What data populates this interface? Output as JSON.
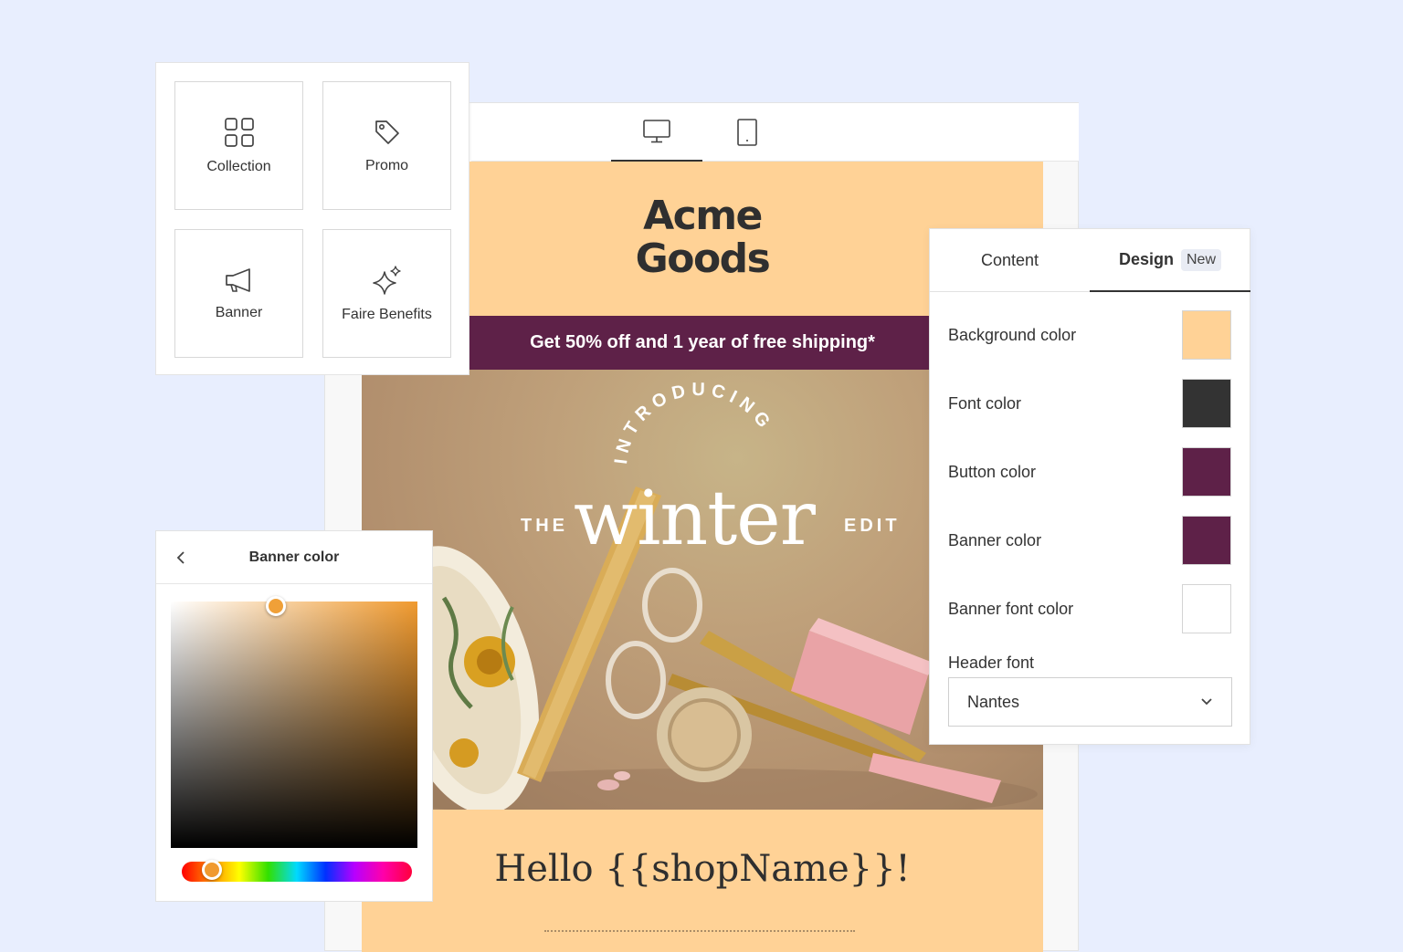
{
  "palette": {
    "items": [
      {
        "label": "Collection",
        "icon": "grid-icon"
      },
      {
        "label": "Promo",
        "icon": "tag-icon"
      },
      {
        "label": "Banner",
        "icon": "megaphone-icon"
      },
      {
        "label": "Faire Benefits",
        "icon": "sparkle-icon"
      }
    ]
  },
  "preview": {
    "devices": [
      {
        "label": "desktop",
        "icon": "desktop-icon",
        "active": true
      },
      {
        "label": "tablet",
        "icon": "tablet-icon",
        "active": false
      }
    ]
  },
  "email": {
    "logo_line1": "Acme",
    "logo_line2": "Goods",
    "banner_text": "Get 50% off and 1 year of free shipping*",
    "hero_introducing": "INTRODUCING",
    "hero_the": "THE",
    "hero_winter": "winter",
    "hero_edit": "EDIT",
    "greeting": "Hello {{shopName}}!"
  },
  "picker": {
    "title": "Banner color",
    "hue_color": "#f09a2f"
  },
  "design_panel": {
    "tabs": [
      {
        "label": "Content",
        "active": false
      },
      {
        "label": "Design",
        "active": true,
        "badge": "New"
      }
    ],
    "settings": [
      {
        "label": "Background color",
        "color": "#ffd296"
      },
      {
        "label": "Font color",
        "color": "#333333"
      },
      {
        "label": "Button color",
        "color": "#5e2148"
      },
      {
        "label": "Banner color",
        "color": "#5e2148"
      },
      {
        "label": "Banner font color",
        "color": "#ffffff"
      }
    ],
    "header_font_label": "Header font",
    "header_font_value": "Nantes"
  },
  "colors": {
    "page_bg": "#e8eefe",
    "email_bg": "#ffd296",
    "banner": "#5e2148",
    "text_dark": "#333333"
  }
}
